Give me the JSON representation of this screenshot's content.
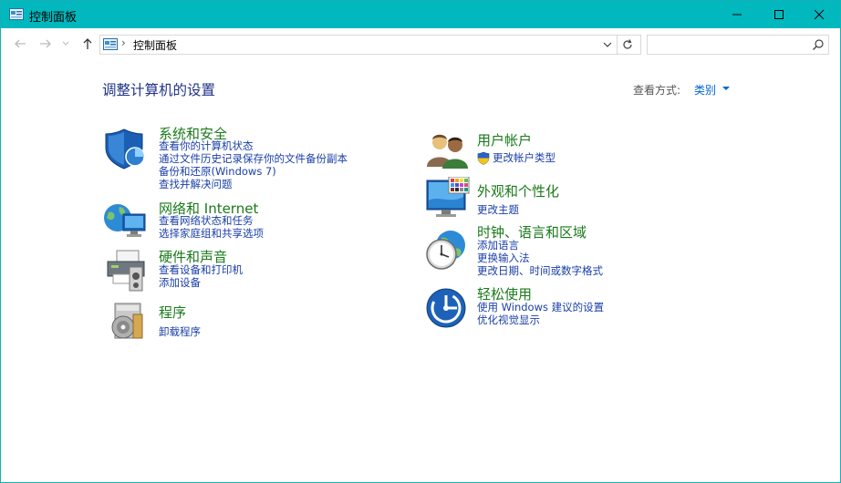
{
  "window": {
    "title": "控制面板"
  },
  "address": {
    "crumb": "控制面板",
    "separator": "›"
  },
  "search": {
    "value": "",
    "placeholder": ""
  },
  "page": {
    "heading": "调整计算机的设置"
  },
  "view": {
    "label": "查看方式:",
    "value": "类别"
  },
  "categories": {
    "system": {
      "title": "系统和安全",
      "links": [
        "查看你的计算机状态",
        "通过文件历史记录保存你的文件备份副本",
        "备份和还原(Windows 7)",
        "查找并解决问题"
      ]
    },
    "network": {
      "title": "网络和 Internet",
      "links": [
        "查看网络状态和任务",
        "选择家庭组和共享选项"
      ]
    },
    "hardware": {
      "title": "硬件和声音",
      "links": [
        "查看设备和打印机",
        "添加设备"
      ]
    },
    "programs": {
      "title": "程序",
      "links": [
        "卸载程序"
      ]
    },
    "users": {
      "title": "用户帐户",
      "links": [
        "更改帐户类型"
      ]
    },
    "appearance": {
      "title": "外观和个性化",
      "links": [
        "更改主题"
      ]
    },
    "clock": {
      "title": "时钟、语言和区域",
      "links": [
        "添加语言",
        "更换输入法",
        "更改日期、时间或数字格式"
      ]
    },
    "ease": {
      "title": "轻松使用",
      "links": [
        "使用 Windows 建议的设置",
        "优化视觉显示"
      ]
    }
  },
  "colors": {
    "titlebar": "#00b8be",
    "category_title": "#1a7a1a",
    "link": "#1a3fa8",
    "heading": "#1e3287"
  }
}
